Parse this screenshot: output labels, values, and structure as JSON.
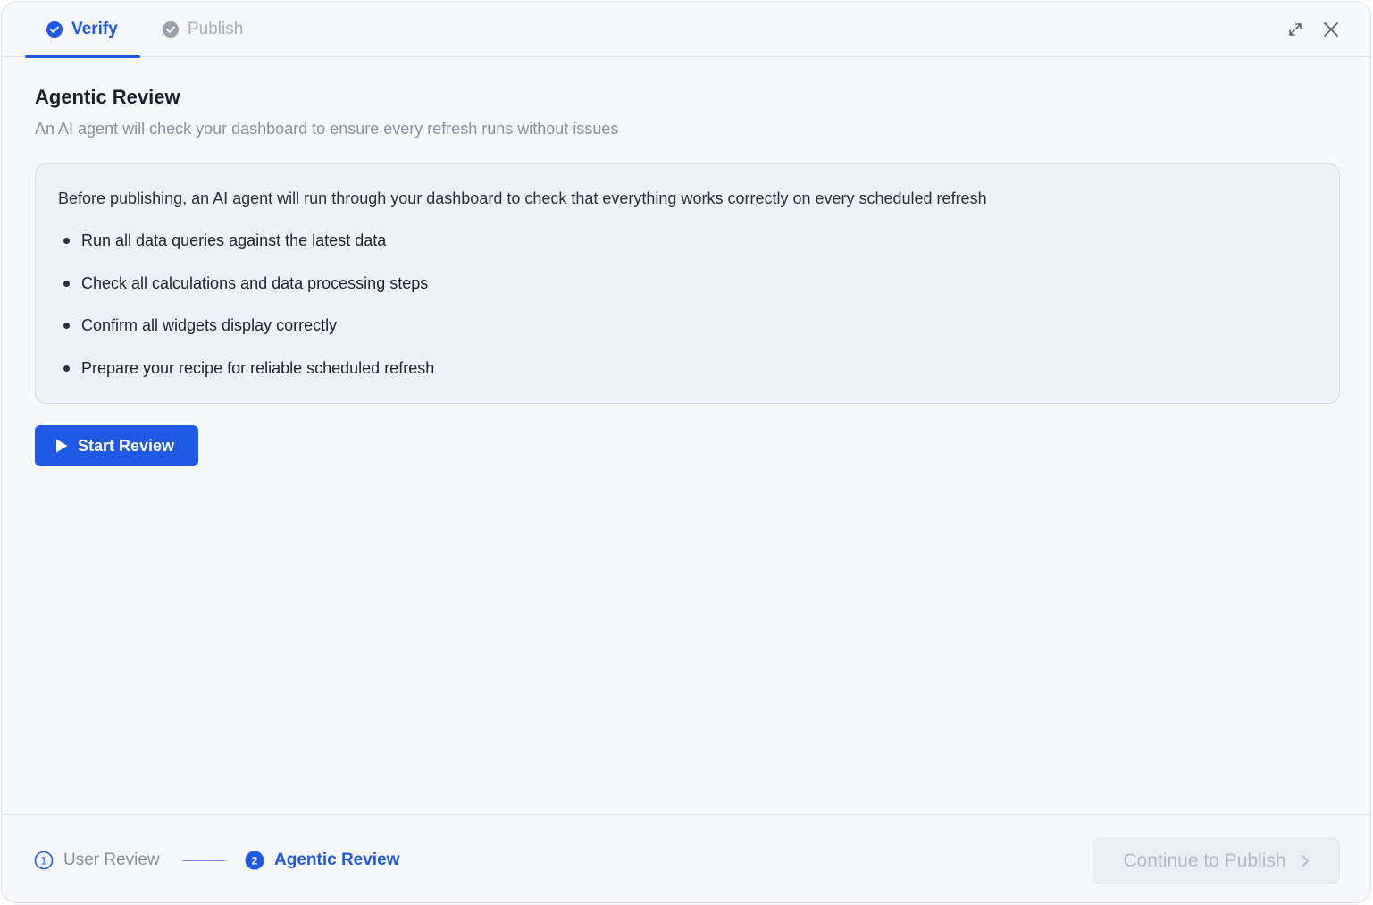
{
  "header": {
    "tabs": [
      {
        "label": "Verify",
        "state": "active"
      },
      {
        "label": "Publish",
        "state": "inactive"
      }
    ],
    "icons": {
      "expand": "expand-icon",
      "close": "close-icon"
    }
  },
  "main": {
    "title": "Agentic Review",
    "subtitle": "An AI agent will check your dashboard to ensure every refresh runs without issues",
    "info": {
      "intro": "Before publishing, an AI agent will run through your dashboard to check that everything works correctly on every scheduled refresh",
      "bullets": [
        "Run all data queries against the latest data",
        "Check all calculations and data processing steps",
        "Confirm all widgets display correctly",
        "Prepare your recipe for reliable scheduled refresh"
      ]
    },
    "start_button": "Start Review"
  },
  "footer": {
    "steps": [
      {
        "number": "1",
        "label": "User Review",
        "state": "completed"
      },
      {
        "number": "2",
        "label": "Agentic Review",
        "state": "current"
      }
    ],
    "continue_button": "Continue to Publish"
  },
  "colors": {
    "accent": "#1f5ae6",
    "muted": "#8a90a0",
    "background": "#f7f8fc",
    "disabled_text": "#b4b9c8"
  }
}
